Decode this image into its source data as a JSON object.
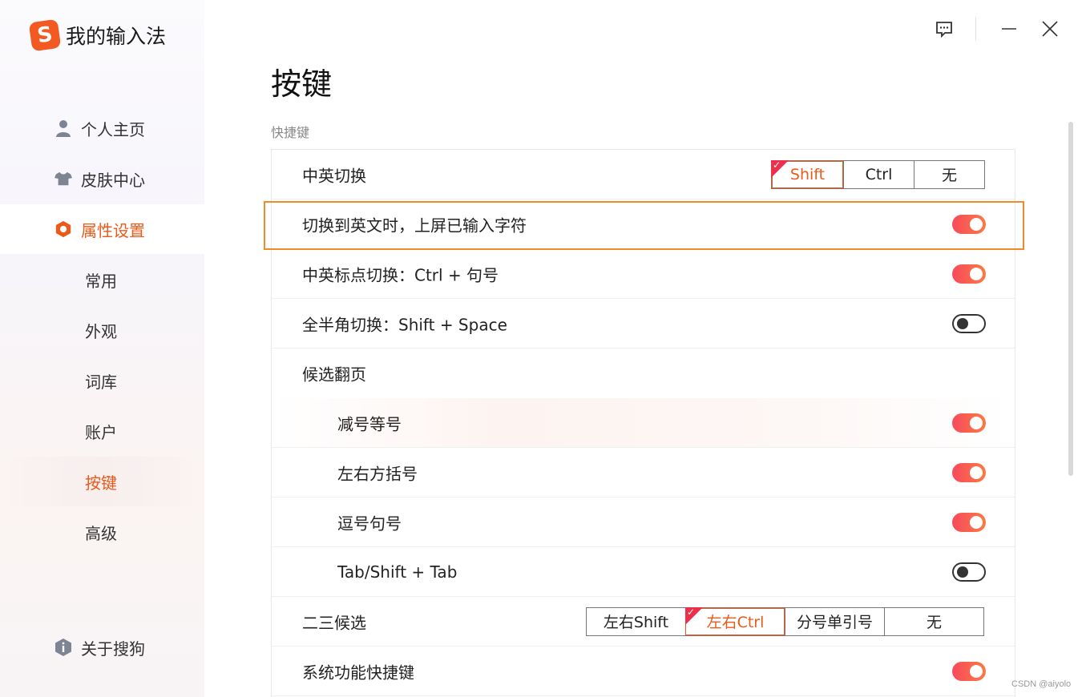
{
  "app": {
    "title": "我的输入法",
    "logo_letter": "S"
  },
  "sidebar": {
    "nav": [
      {
        "label": "个人主页",
        "icon": "user-icon"
      },
      {
        "label": "皮肤中心",
        "icon": "tshirt-icon"
      },
      {
        "label": "属性设置",
        "icon": "hexagon-settings-icon",
        "active": true
      }
    ],
    "sub": [
      {
        "label": "常用"
      },
      {
        "label": "外观"
      },
      {
        "label": "词库"
      },
      {
        "label": "账户"
      },
      {
        "label": "按键",
        "active": true
      },
      {
        "label": "高级"
      }
    ],
    "about": {
      "label": "关于搜狗",
      "icon": "info-shield-icon"
    }
  },
  "window": {
    "feedback_icon": "feedback-icon",
    "minimize_icon": "minimize-icon",
    "close_icon": "close-icon"
  },
  "main": {
    "title": "按键",
    "section_label": "快捷键",
    "switch_cn_en": {
      "label": "中英切换",
      "options": [
        "Shift",
        "Ctrl",
        "无"
      ],
      "selected": "Shift"
    },
    "commit_on_switch": {
      "label": "切换到英文时，上屏已输入字符",
      "on": true
    },
    "punct_switch": {
      "label": "中英标点切换：Ctrl + 句号",
      "on": true
    },
    "width_switch": {
      "label": "全半角切换：Shift + Space",
      "on": false
    },
    "paging": {
      "label": "候选翻页",
      "items": [
        {
          "label": "减号等号",
          "on": true
        },
        {
          "label": "左右方括号",
          "on": true
        },
        {
          "label": "逗号句号",
          "on": true
        },
        {
          "label": "Tab/Shift + Tab",
          "on": false
        }
      ]
    },
    "second_third": {
      "label": "二三候选",
      "options": [
        "左右Shift",
        "左右Ctrl",
        "分号单引号",
        "无"
      ],
      "selected": "左右Ctrl"
    },
    "system_hotkeys": {
      "label": "系统功能快捷键",
      "on": true
    }
  },
  "colors": {
    "accent": "#ec5a1a",
    "toggle_on_start": "#f74a5c",
    "toggle_on_end": "#fb7a42",
    "highlight_frame": "#f08a2a"
  },
  "watermark": "CSDN @aiyolo"
}
